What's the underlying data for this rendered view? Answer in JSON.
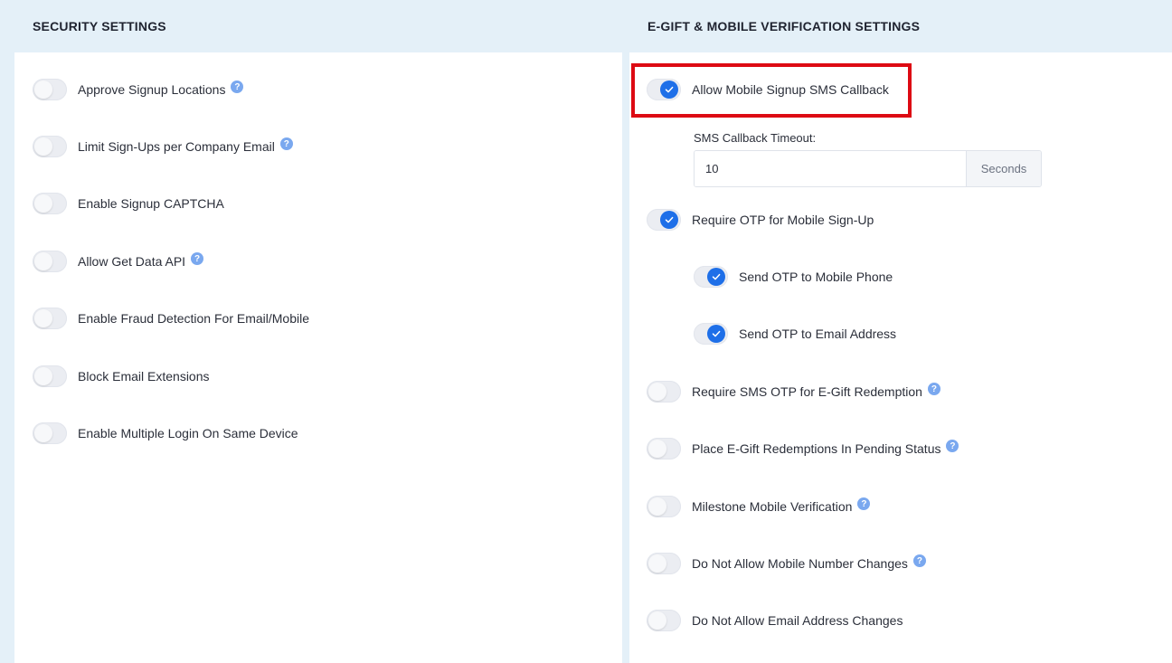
{
  "security": {
    "title": "SECURITY SETTINGS",
    "items": [
      {
        "label": "Approve Signup Locations",
        "on": false,
        "help": true
      },
      {
        "label": "Limit Sign-Ups per Company Email",
        "on": false,
        "help": true
      },
      {
        "label": "Enable Signup CAPTCHA",
        "on": false,
        "help": false
      },
      {
        "label": "Allow Get Data API",
        "on": false,
        "help": true
      },
      {
        "label": "Enable Fraud Detection For Email/Mobile",
        "on": false,
        "help": false
      },
      {
        "label": "Block Email Extensions",
        "on": false,
        "help": false
      },
      {
        "label": "Enable Multiple Login On Same Device",
        "on": false,
        "help": false
      }
    ]
  },
  "egift": {
    "title": "E-GIFT & MOBILE VERIFICATION SETTINGS",
    "sms_callback": {
      "label": "Allow Mobile Signup SMS Callback",
      "on": true
    },
    "timeout": {
      "label": "SMS Callback Timeout:",
      "value": "10",
      "suffix": "Seconds"
    },
    "require_otp": {
      "label": "Require OTP for Mobile Sign-Up",
      "on": true
    },
    "otp_phone": {
      "label": "Send OTP to Mobile Phone",
      "on": true
    },
    "otp_email": {
      "label": "Send OTP to Email Address",
      "on": true
    },
    "items": [
      {
        "label": "Require SMS OTP for E-Gift Redemption",
        "on": false,
        "help": true
      },
      {
        "label": "Place E-Gift Redemptions In Pending Status",
        "on": false,
        "help": true
      },
      {
        "label": "Milestone Mobile Verification",
        "on": false,
        "help": true
      },
      {
        "label": "Do Not Allow Mobile Number Changes",
        "on": false,
        "help": true
      },
      {
        "label": "Do Not Allow Email Address Changes",
        "on": false,
        "help": false
      }
    ]
  },
  "help_glyph": "?",
  "colors": {
    "accent": "#1e6fe8",
    "highlight": "#dd0a13",
    "help": "#7aa8ef"
  }
}
